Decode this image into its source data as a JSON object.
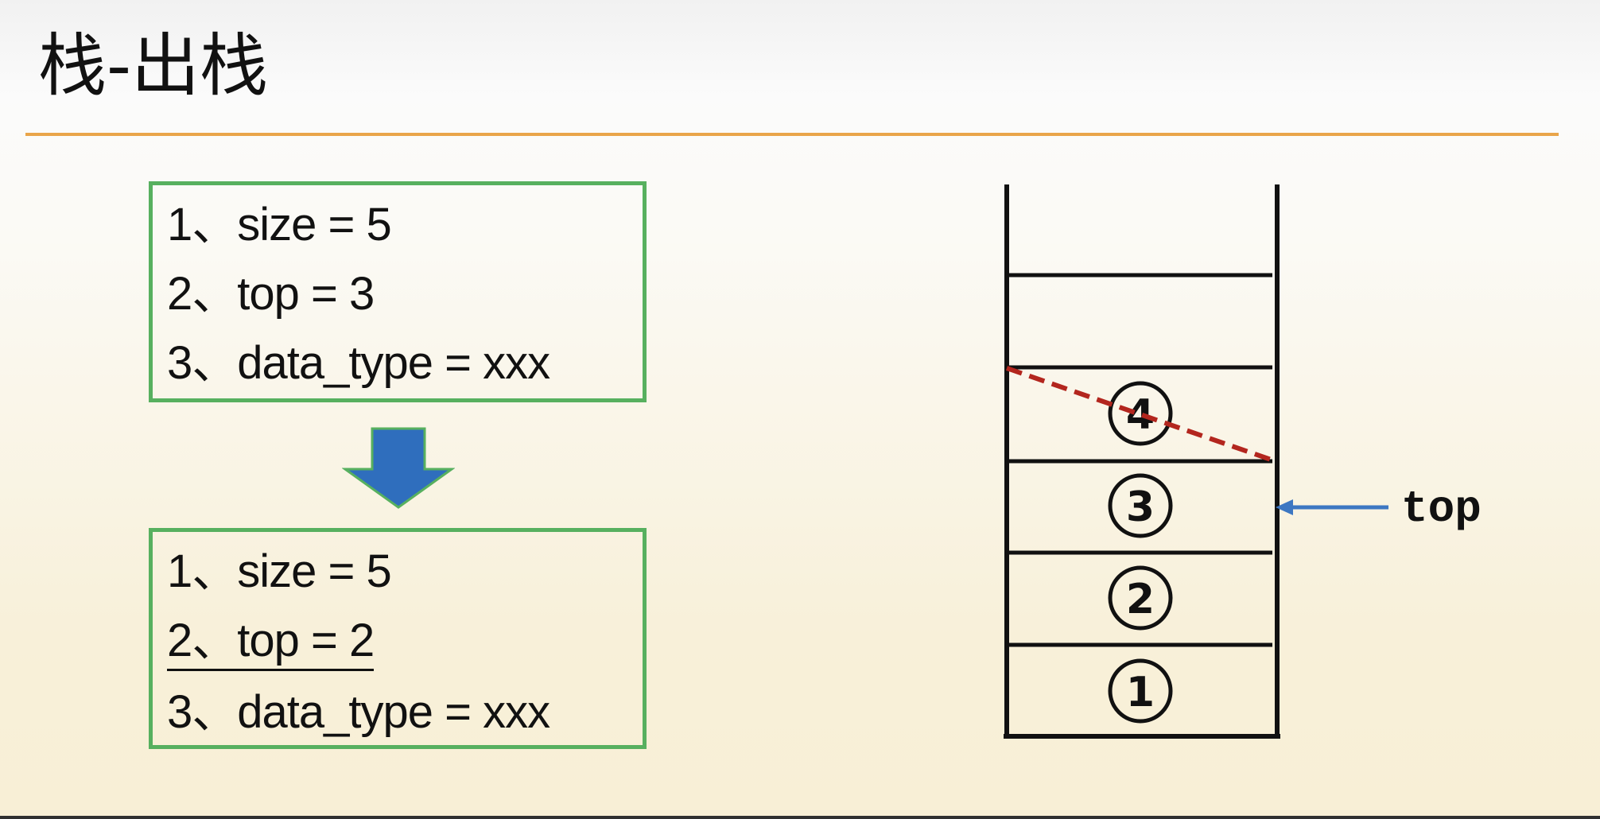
{
  "title": "栈-出栈",
  "before_box": {
    "lines": [
      "1、size = 5",
      "2、top = 3",
      "3、data_type = xxx"
    ]
  },
  "after_box": {
    "lines": [
      "1、size = 5",
      "2、top = 2",
      "3、data_type = xxx"
    ]
  },
  "stack": {
    "capacity": 5,
    "slots": [
      "1",
      "2",
      "3",
      "4"
    ],
    "popped_slot": "4",
    "top_label": "top",
    "top_slot": "3"
  },
  "colors": {
    "title_rule": "#e9a54a",
    "box_border": "#57b05f",
    "down_arrow_fill": "#2f6ebd",
    "down_arrow_border": "#57b05f",
    "pointer_arrow": "#3d77c2",
    "strike_line": "#b3261e"
  }
}
